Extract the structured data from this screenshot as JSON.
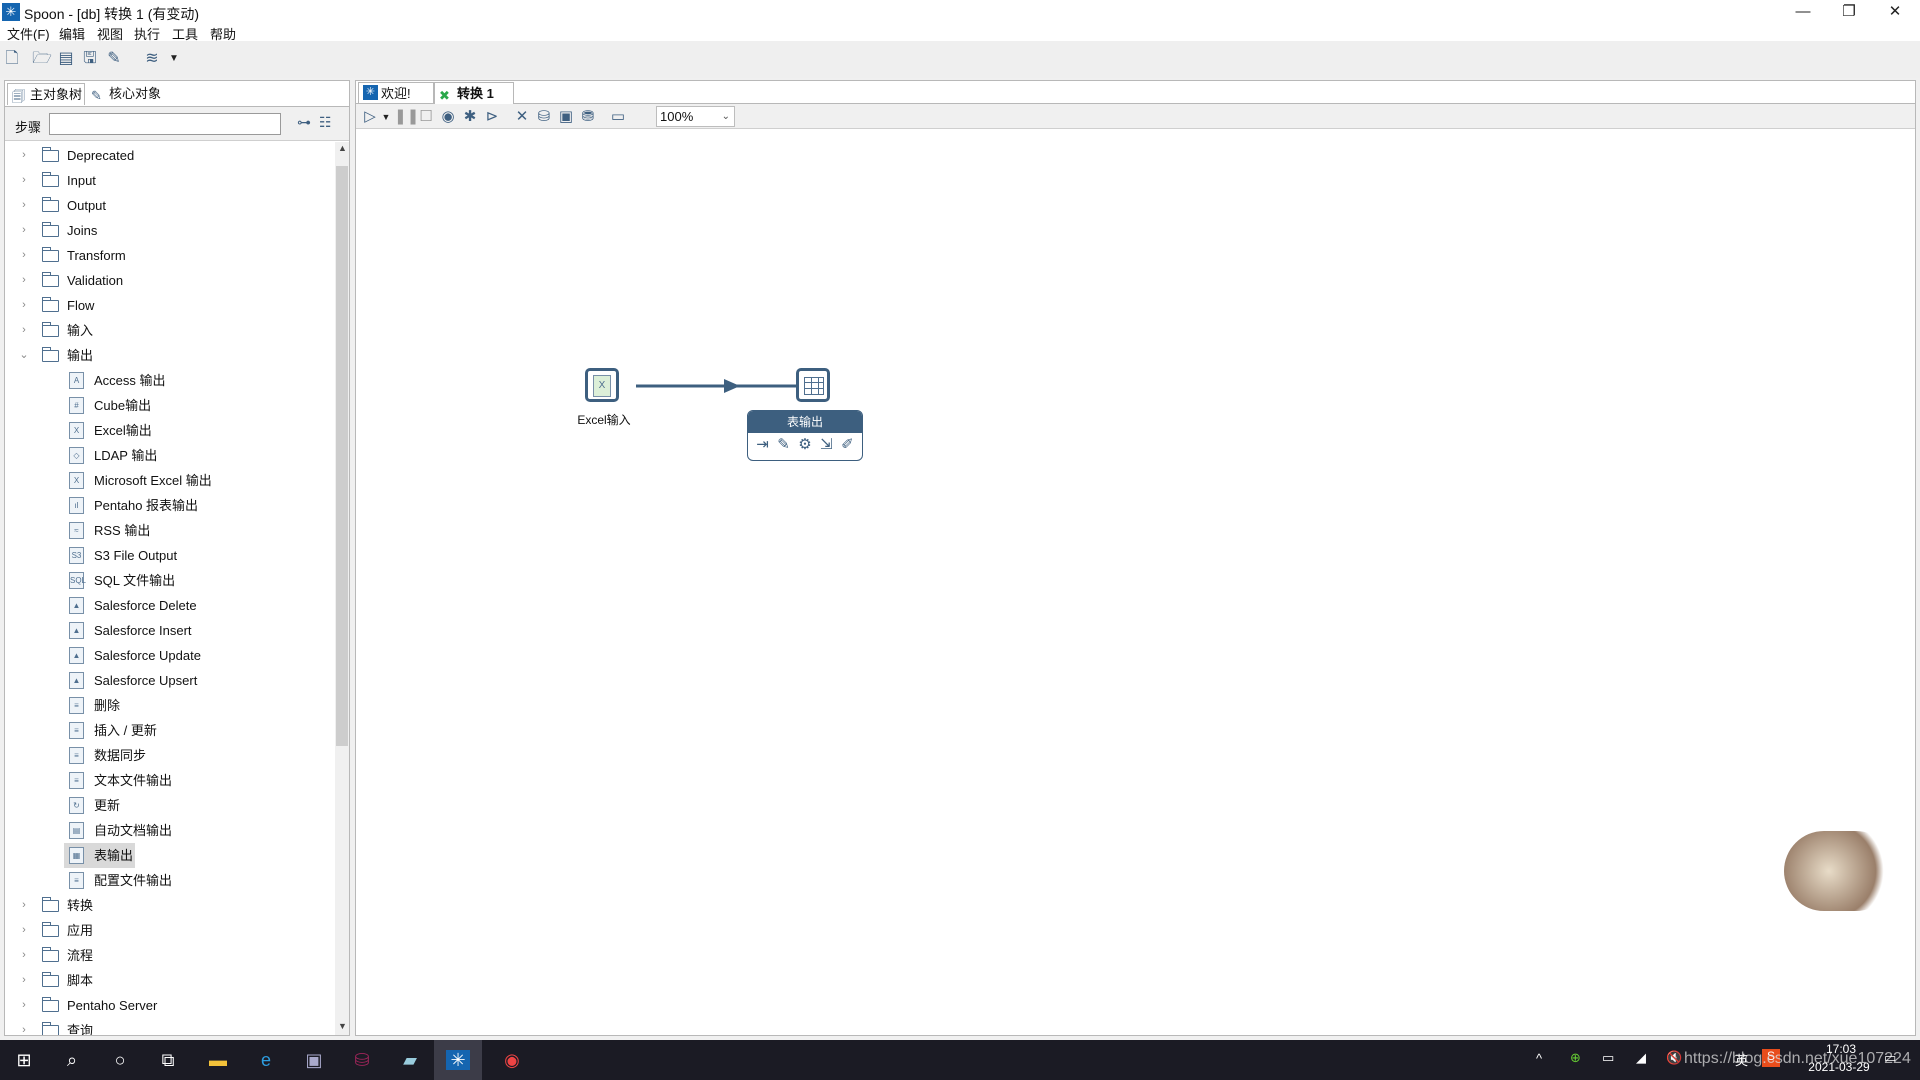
{
  "window": {
    "title": "Spoon - [db] 转换 1 (有变动)",
    "minimize": "—",
    "restore": "❐",
    "close": "✕"
  },
  "menu": [
    "文件(F)",
    "编辑",
    "视图",
    "执行",
    "工具",
    "帮助"
  ],
  "toolbar": {
    "repository": "db"
  },
  "left_tabs": [
    "主对象树",
    "核心对象"
  ],
  "steps": {
    "label": "步骤",
    "search_value": ""
  },
  "tree": [
    {
      "label": "Deprecated",
      "type": "folder",
      "expanded": false
    },
    {
      "label": "Input",
      "type": "folder",
      "expanded": false
    },
    {
      "label": "Output",
      "type": "folder",
      "expanded": false
    },
    {
      "label": "Joins",
      "type": "folder",
      "expanded": false
    },
    {
      "label": "Transform",
      "type": "folder",
      "expanded": false
    },
    {
      "label": "Validation",
      "type": "folder",
      "expanded": false
    },
    {
      "label": "Flow",
      "type": "folder",
      "expanded": false
    },
    {
      "label": "输入",
      "type": "folder",
      "expanded": false
    },
    {
      "label": "输出",
      "type": "folder",
      "expanded": true
    },
    {
      "label": "Access 输出",
      "type": "step",
      "icon": "A"
    },
    {
      "label": "Cube输出",
      "type": "step",
      "icon": "#"
    },
    {
      "label": "Excel输出",
      "type": "step",
      "icon": "X"
    },
    {
      "label": "LDAP 输出",
      "type": "step",
      "icon": "◇"
    },
    {
      "label": "Microsoft Excel 输出",
      "type": "step",
      "icon": "X"
    },
    {
      "label": "Pentaho 报表输出",
      "type": "step",
      "icon": "ıl"
    },
    {
      "label": "RSS 输出",
      "type": "step",
      "icon": "≈"
    },
    {
      "label": "S3 File Output",
      "type": "step",
      "icon": "S3"
    },
    {
      "label": "SQL 文件输出",
      "type": "step",
      "icon": "SQL"
    },
    {
      "label": "Salesforce Delete",
      "type": "step",
      "icon": "▲"
    },
    {
      "label": "Salesforce Insert",
      "type": "step",
      "icon": "▲"
    },
    {
      "label": "Salesforce Update",
      "type": "step",
      "icon": "▲"
    },
    {
      "label": "Salesforce Upsert",
      "type": "step",
      "icon": "▲"
    },
    {
      "label": "删除",
      "type": "step",
      "icon": "≡"
    },
    {
      "label": "插入 / 更新",
      "type": "step",
      "icon": "≡"
    },
    {
      "label": "数据同步",
      "type": "step",
      "icon": "≡"
    },
    {
      "label": "文本文件输出",
      "type": "step",
      "icon": "≡"
    },
    {
      "label": "更新",
      "type": "step",
      "icon": "↻"
    },
    {
      "label": "自动文档输出",
      "type": "step",
      "icon": "▤"
    },
    {
      "label": "表输出",
      "type": "step",
      "icon": "▦",
      "selected": true
    },
    {
      "label": "配置文件输出",
      "type": "step",
      "icon": "≡"
    },
    {
      "label": "转换",
      "type": "folder",
      "expanded": false
    },
    {
      "label": "应用",
      "type": "folder",
      "expanded": false
    },
    {
      "label": "流程",
      "type": "folder",
      "expanded": false
    },
    {
      "label": "脚本",
      "type": "folder",
      "expanded": false
    },
    {
      "label": "Pentaho Server",
      "type": "folder",
      "expanded": false
    },
    {
      "label": "查询",
      "type": "folder",
      "expanded": false
    }
  ],
  "editor_tabs": [
    {
      "label": "欢迎!"
    },
    {
      "label": "转换 1",
      "active": true,
      "close": "☒"
    }
  ],
  "canvas_toolbar": {
    "zoom": "100%"
  },
  "canvas": {
    "nodes": [
      {
        "label": "Excel输入",
        "icon": "excel-input"
      },
      {
        "label": "表输出",
        "icon": "table-output"
      }
    ],
    "hop": {
      "from": "Excel输入",
      "to": "表输出"
    },
    "popup": {
      "title": "表输出",
      "actions": [
        "input-icon",
        "edit-icon",
        "settings-icon",
        "output-icon",
        "inject-icon"
      ]
    }
  },
  "taskbar": {
    "clock_time": "17:03",
    "clock_date": "2021-03-29",
    "ime": "英",
    "watermark": "https://blog.csdn.net/xue107224"
  },
  "colors": {
    "accent": "#3d5f7f",
    "taskbar": "#1b1b24",
    "selection": "#d9d9d9"
  }
}
